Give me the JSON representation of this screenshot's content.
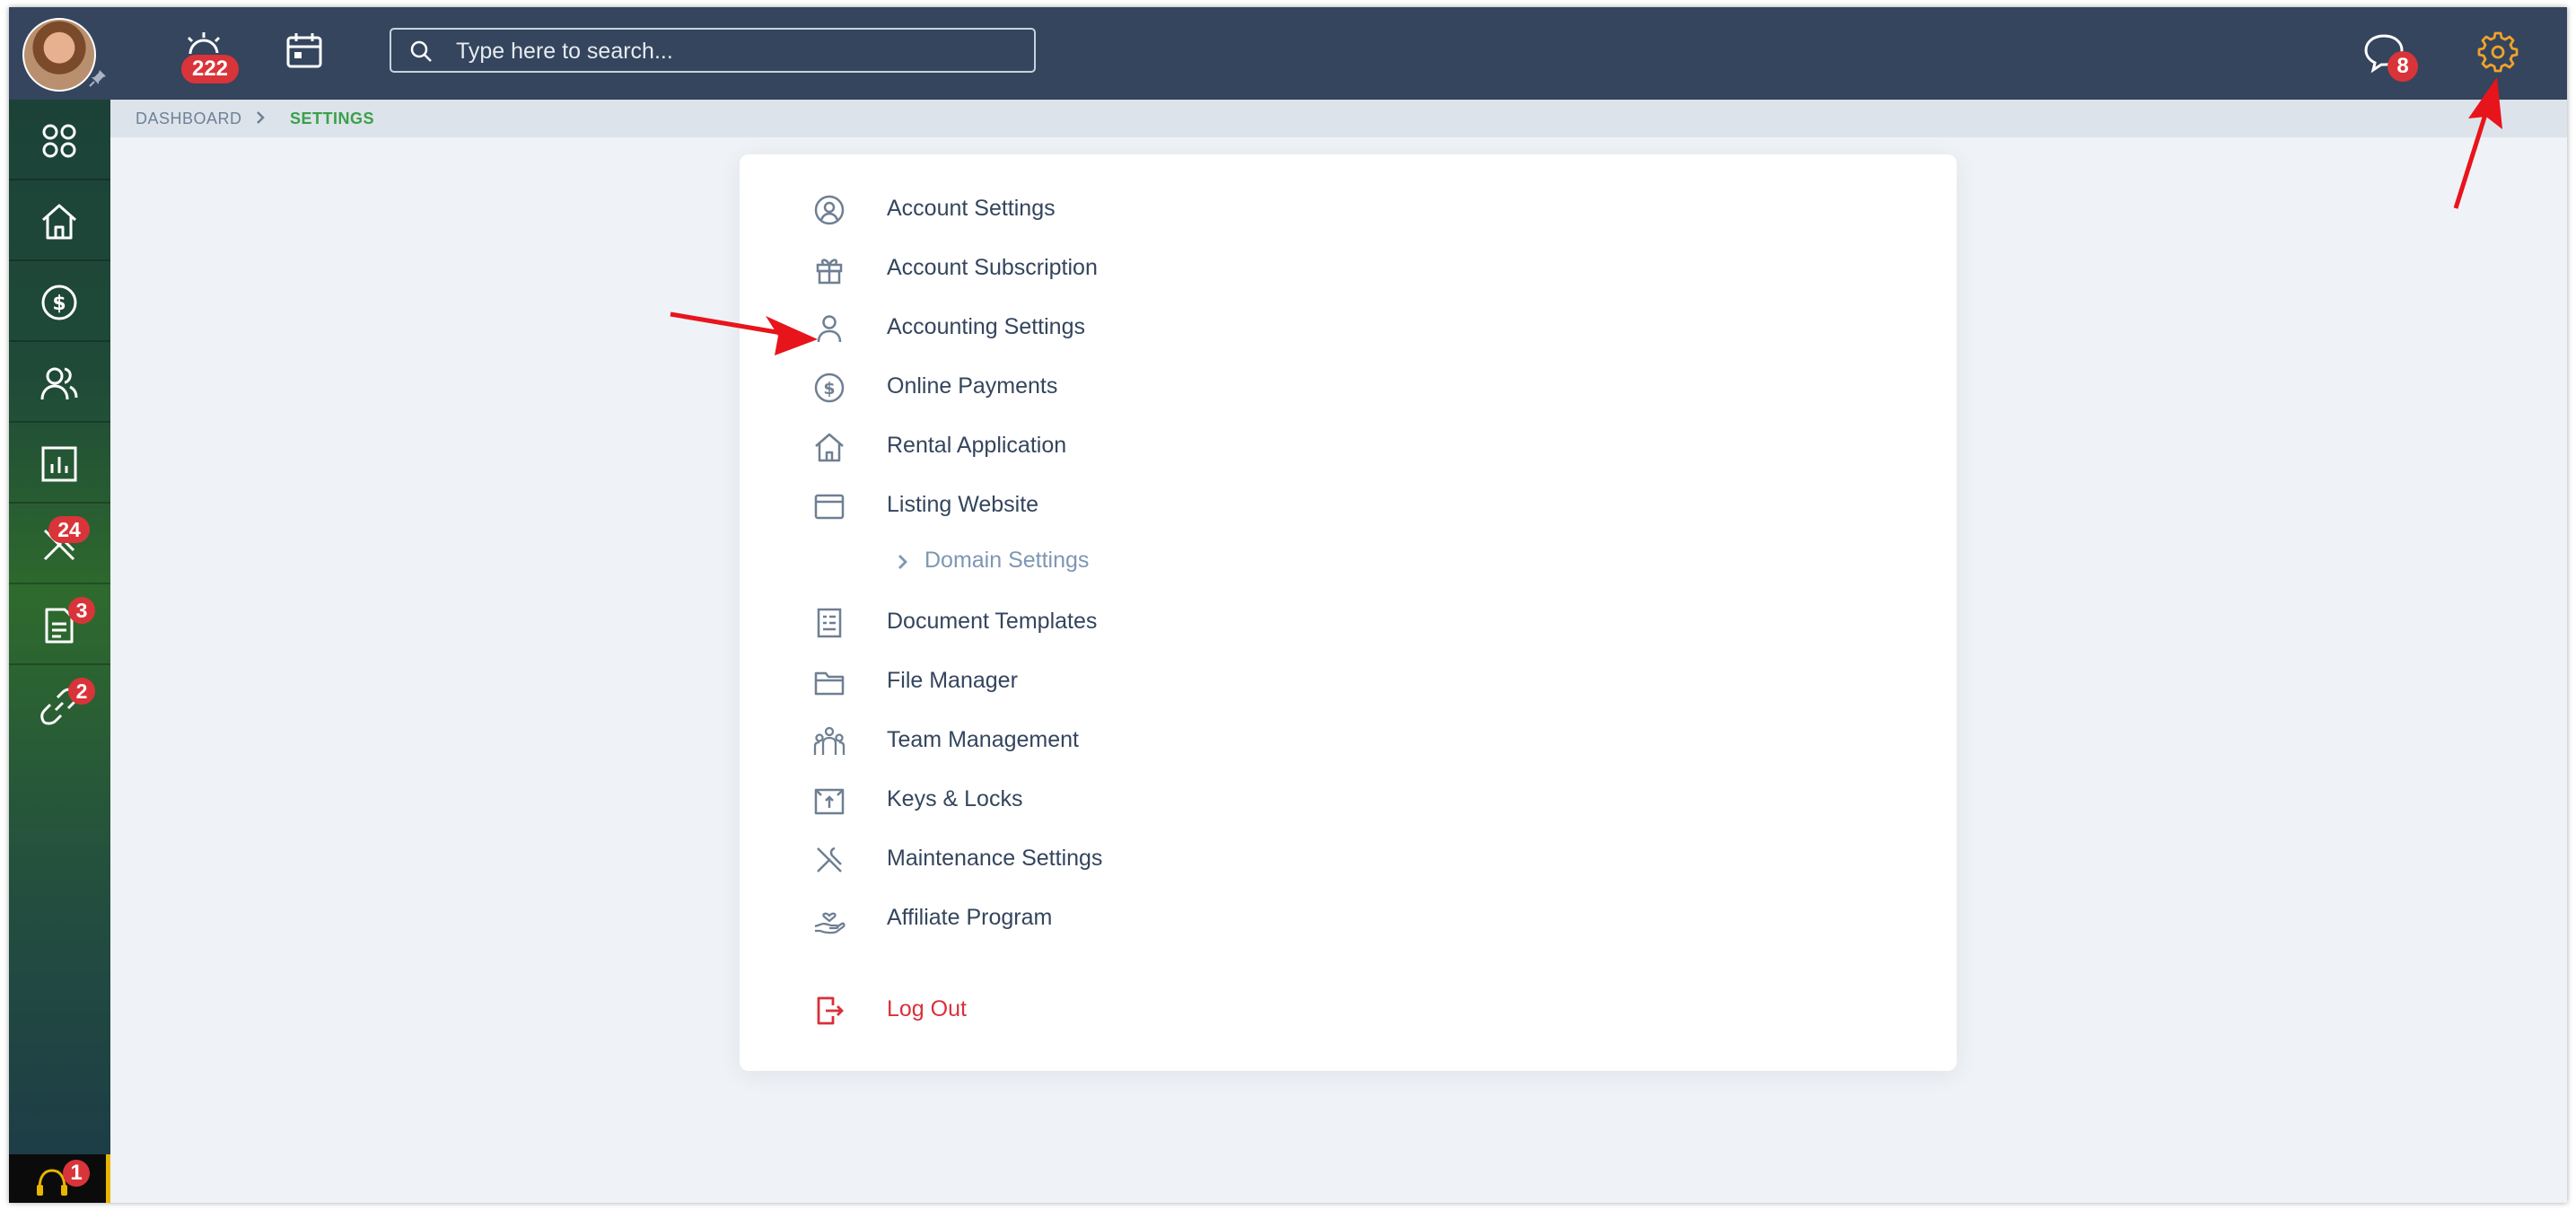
{
  "topbar": {
    "alarm_badge": "222",
    "search_placeholder": "Type here to search...",
    "chat_badge": "8"
  },
  "sidebar": {
    "items": [
      {
        "name": "apps",
        "badge": ""
      },
      {
        "name": "home",
        "badge": ""
      },
      {
        "name": "payments",
        "badge": ""
      },
      {
        "name": "people",
        "badge": ""
      },
      {
        "name": "reports",
        "badge": ""
      },
      {
        "name": "maintenance",
        "badge": "24"
      },
      {
        "name": "documents",
        "badge": "3"
      },
      {
        "name": "links",
        "badge": "2"
      }
    ],
    "support_badge": "1"
  },
  "breadcrumb": {
    "root": "DASHBOARD",
    "current": "SETTINGS"
  },
  "settings_menu": {
    "items": [
      {
        "label": "Account Settings",
        "icon": "user-circle-icon"
      },
      {
        "label": "Account Subscription",
        "icon": "gift-icon"
      },
      {
        "label": "Accounting Settings",
        "icon": "user-icon"
      },
      {
        "label": "Online Payments",
        "icon": "dollar-circle-icon"
      },
      {
        "label": "Rental Application",
        "icon": "house-icon"
      },
      {
        "label": "Listing Website",
        "icon": "browser-window-icon"
      },
      {
        "label": "Domain Settings",
        "icon": "chevron-right-icon"
      },
      {
        "label": "Document Templates",
        "icon": "document-icon"
      },
      {
        "label": "File Manager",
        "icon": "folder-icon"
      },
      {
        "label": "Team Management",
        "icon": "team-icon"
      },
      {
        "label": "Keys & Locks",
        "icon": "key-box-icon"
      },
      {
        "label": "Maintenance Settings",
        "icon": "tools-icon"
      },
      {
        "label": "Affiliate Program",
        "icon": "hand-heart-icon"
      }
    ],
    "logout_label": "Log Out"
  },
  "colors": {
    "topbar": "#34455d",
    "accent_orange": "#f0a22a",
    "badge_red": "#d93439",
    "breadcrumb_green": "#3aa04a",
    "logout_red": "#d8303a",
    "annotation_red": "#e8141b"
  }
}
